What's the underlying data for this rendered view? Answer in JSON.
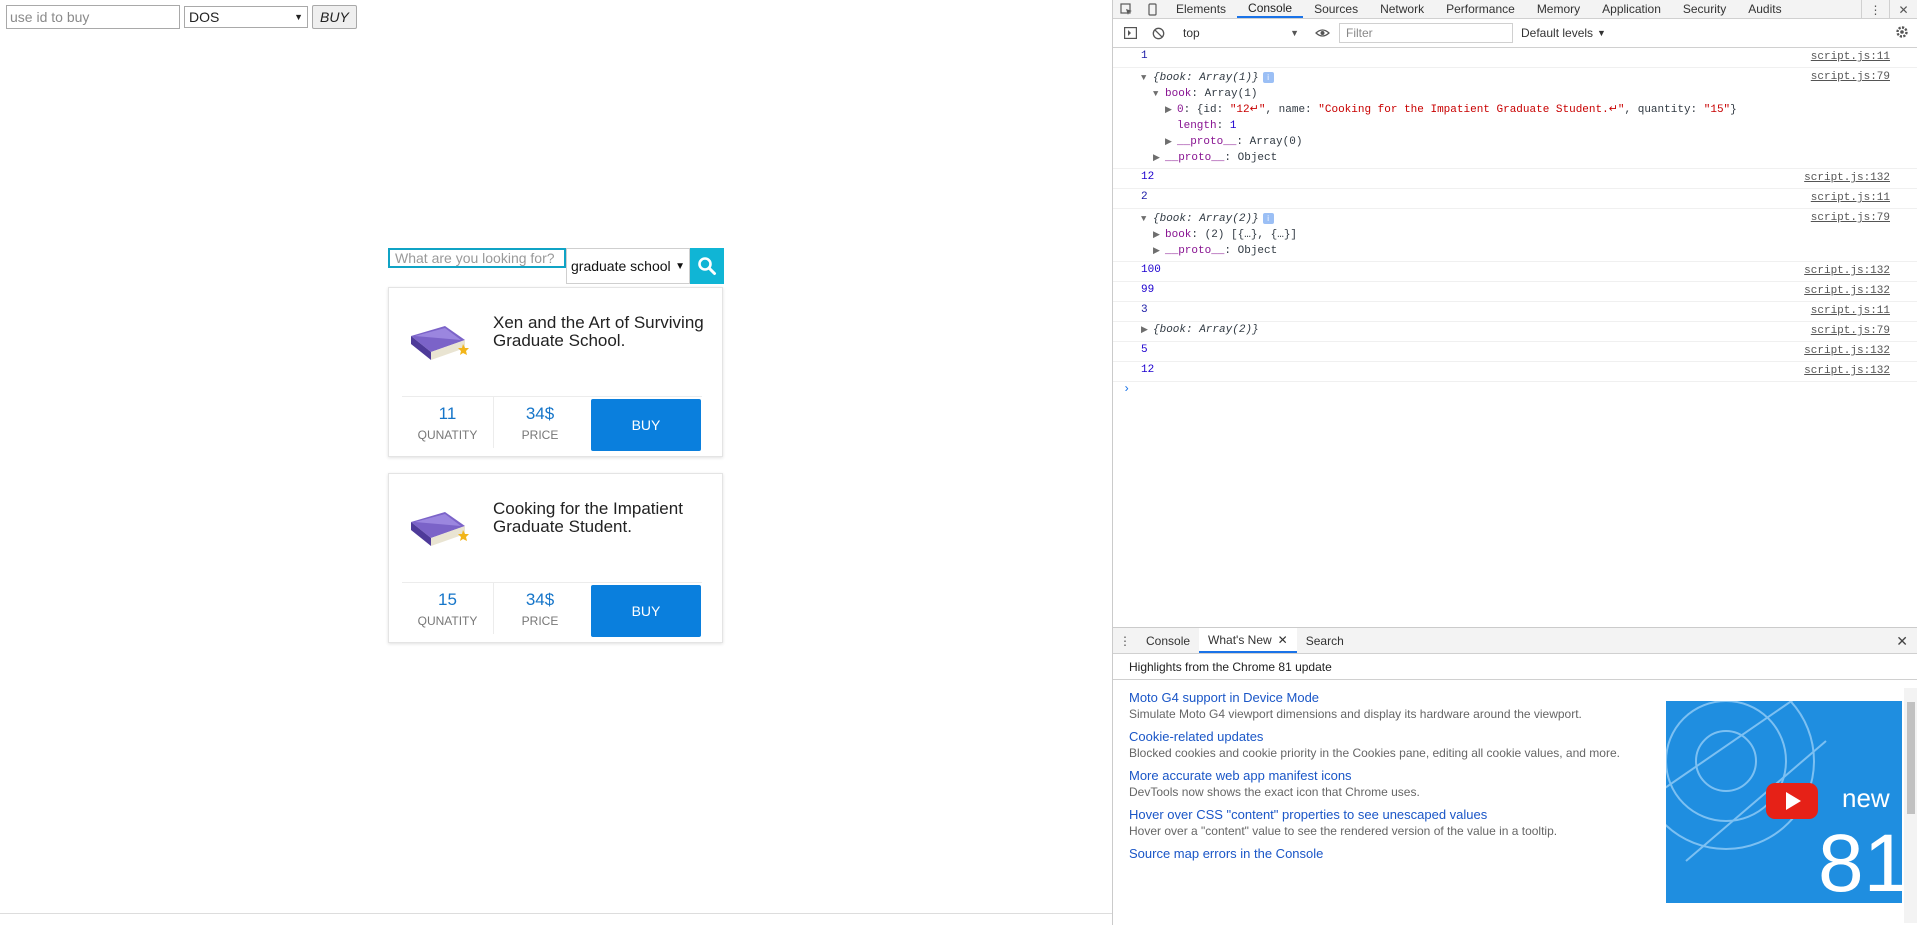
{
  "buy_bar": {
    "id_placeholder": "use id to buy",
    "payment_selected": "DOS",
    "buy_label": "BUY"
  },
  "store": {
    "search_placeholder": "What are you looking for?",
    "category_selected": "graduate school",
    "books": [
      {
        "title": "Xen and the Art of Surviving Graduate School.",
        "quantity": "11",
        "quantity_label": "QUNATITY",
        "price": "34$",
        "price_label": "PRICE",
        "buy_label": "BUY"
      },
      {
        "title": "Cooking for the Impatient Graduate Student.",
        "quantity": "15",
        "quantity_label": "QUNATITY",
        "price": "34$",
        "price_label": "PRICE",
        "buy_label": "BUY"
      }
    ]
  },
  "devtools": {
    "tabs": [
      "Elements",
      "Console",
      "Sources",
      "Network",
      "Performance",
      "Memory",
      "Application",
      "Security",
      "Audits"
    ],
    "active_tab": "Console",
    "context": "top",
    "filter_placeholder": "Filter",
    "levels": "Default levels",
    "log": {
      "l1": {
        "value": "1",
        "source": "script.js:11"
      },
      "l2": {
        "summary": "{book: Array(1)}",
        "source": "script.js:79",
        "book_key": "book",
        "book_val": "Array(1)",
        "item0_key": "0",
        "item0_id_val": "\"12↵\"",
        "item0_name_val": "\"Cooking for the Impatient Graduate Student.↵\"",
        "item0_qty_val": "\"15\"",
        "length_key": "length",
        "length_val": "1",
        "proto_key": "__proto__",
        "proto_arr_val": "Array(0)",
        "proto_obj_val": "Object"
      },
      "l3": {
        "value": "12",
        "source": "script.js:132"
      },
      "l4": {
        "value": "2",
        "source": "script.js:11"
      },
      "l5": {
        "summary": "{book: Array(2)}",
        "source": "script.js:79",
        "book_key": "book",
        "book_val": "(2) [{…}, {…}]",
        "proto_key": "__proto__",
        "proto_val": "Object"
      },
      "l6": {
        "value": "100",
        "source": "script.js:132"
      },
      "l7": {
        "value": "99",
        "source": "script.js:132"
      },
      "l8": {
        "value": "3",
        "source": "script.js:11"
      },
      "l9": {
        "summary": "{book: Array(2)}",
        "source": "script.js:79"
      },
      "l10": {
        "value": "5",
        "source": "script.js:132"
      },
      "l11": {
        "value": "12",
        "source": "script.js:132"
      }
    },
    "drawer": {
      "tabs": [
        "Console",
        "What's New",
        "Search"
      ],
      "active_tab": "What's New",
      "highlights": "Highlights from the Chrome 81 update",
      "items": [
        {
          "title": "Moto G4 support in Device Mode",
          "desc": "Simulate Moto G4 viewport dimensions and display its hardware around the viewport."
        },
        {
          "title": "Cookie-related updates",
          "desc": "Blocked cookies and cookie priority in the Cookies pane, editing all cookie values, and more."
        },
        {
          "title": "More accurate web app manifest icons",
          "desc": "DevTools now shows the exact icon that Chrome uses."
        },
        {
          "title": "Hover over CSS \"content\" properties to see unescaped values",
          "desc": "Hover over a \"content\" value to see the rendered version of the value in a tooltip."
        },
        {
          "title": "Source map errors in the Console",
          "desc": ""
        }
      ],
      "video_text_top": "new",
      "video_text_big": "81"
    }
  },
  "colors": {
    "accent": "#10b5d5",
    "buy_blue": "#0a7fdd",
    "link_blue": "#1a56c7"
  }
}
